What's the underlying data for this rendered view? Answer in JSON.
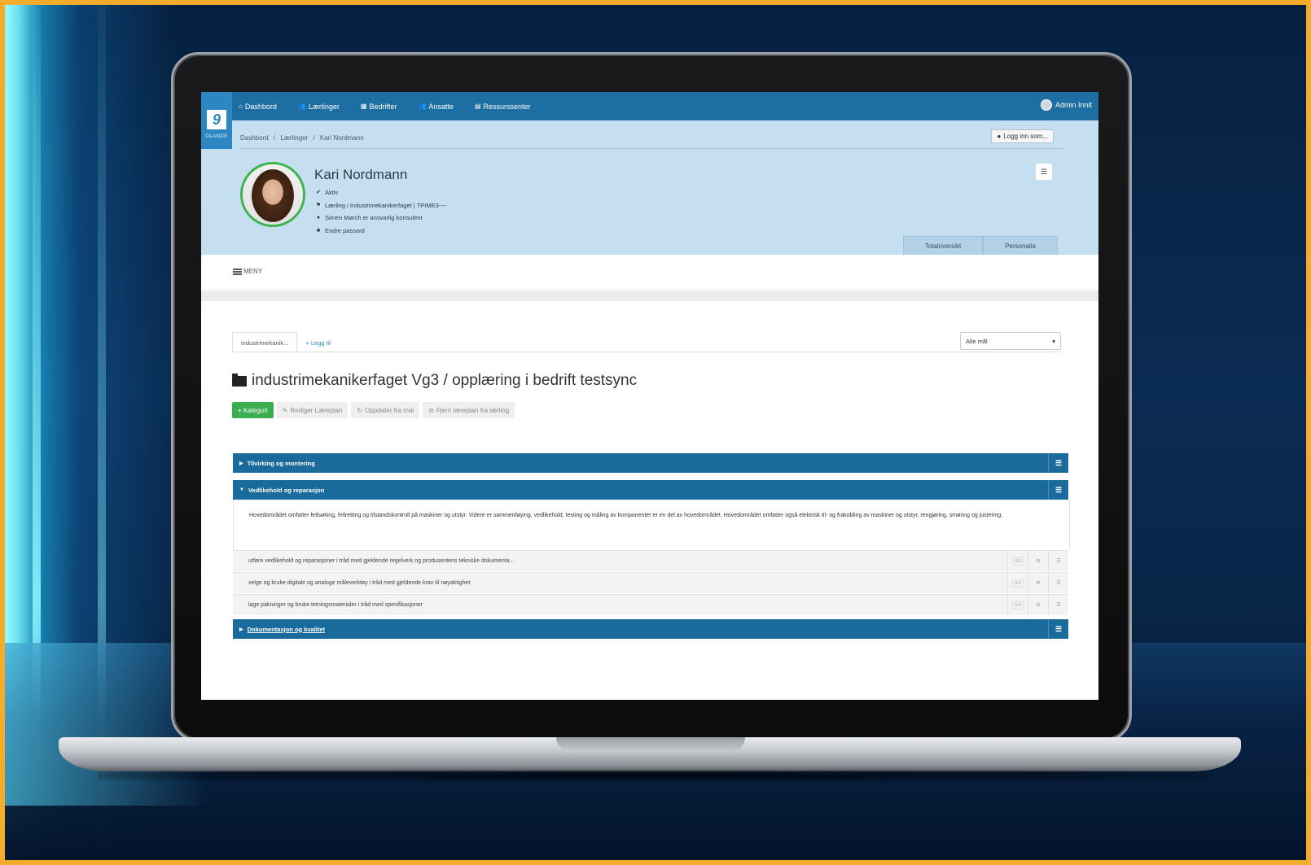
{
  "nav": {
    "logo_letter": "9",
    "logo_text": "OLANDE",
    "items": [
      {
        "icon": "⌂",
        "icon_name": "home-icon",
        "label": "Dashbord"
      },
      {
        "icon": "👥",
        "icon_name": "users-icon",
        "label": "Lærlinger"
      },
      {
        "icon": "▦",
        "icon_name": "building-icon",
        "label": "Bedrifter"
      },
      {
        "icon": "👥",
        "icon_name": "users-icon",
        "label": "Ansatte"
      },
      {
        "icon": "▤",
        "icon_name": "file-icon",
        "label": "Ressurssenter"
      }
    ],
    "admin_label": "Admin Innit"
  },
  "breadcrumb": [
    "Dashbord",
    "/",
    "Lærlinger",
    "/",
    "Kari Nordmann"
  ],
  "header": {
    "login_as": "Logg inn som...",
    "name": "Kari Nordmann",
    "lines": [
      {
        "icon": "✔",
        "icon_name": "check-icon",
        "text": "Aktiv"
      },
      {
        "icon": "⚑",
        "icon_name": "flag-icon",
        "text": "Lærling i Industrimekanikerfaget | TPIME3----"
      },
      {
        "icon": "●",
        "icon_name": "user-icon",
        "text": "Simen Mørch er ansvarlig konsulent"
      },
      {
        "icon": "■",
        "icon_name": "lock-icon",
        "text": "Endre passord"
      }
    ],
    "tabs": [
      "Totaloversikt",
      "Personalia"
    ]
  },
  "menu": {
    "label": "MENY"
  },
  "content": {
    "tab_active": "industrimekanik...",
    "tab_add": "+ Legg til",
    "select_value": "Alle mål",
    "plan_title": "industrimekanikerfaget Vg3 / opplæring i bedrift testsync",
    "buttons": {
      "category": "+ Kategori",
      "edit": "Rediger Læreplan",
      "update": "Oppdater fra mal",
      "remove": "Fjern læreplan fra lærling"
    },
    "sections": [
      {
        "title": "Tilvirking og montering",
        "expanded": false
      },
      {
        "title": "Vedlikehold og reparasjon",
        "expanded": true
      },
      {
        "title": "Dokumentasjon og kvalitet",
        "expanded": false
      }
    ],
    "section_description": "Hovedområdet omfatter feilsøking, feilretting og tilstandskontroll på maskiner og utstyr. Videre er sammenføying, vedlikehold, testing og måling av komponenter er en del av hovedområdet. Hovedområdet omfatter også elektrisk til- og frakobling av maskiner og utstyr, rengjøring, smøring og justering.",
    "goals": [
      "utføre vedlikehold og reparasjoner i tråd med gjeldende regelverk og produsentens tekniske dokumenta...",
      "velge og bruke digitale og analoge måleverktøy i tråd med gjeldende krav til nøyaktighet",
      "lage pakninger og bruke tetningsmaterialer i tråd med spesifikasjoner"
    ],
    "goal_badge": "0/0",
    "goal_gear": "⚙",
    "menu_glyph": "☰"
  },
  "colors": {
    "brand": "#1d6ea3",
    "header_bg": "#c5dff0",
    "green": "#3cae52",
    "frame": "#f4ac2c"
  }
}
